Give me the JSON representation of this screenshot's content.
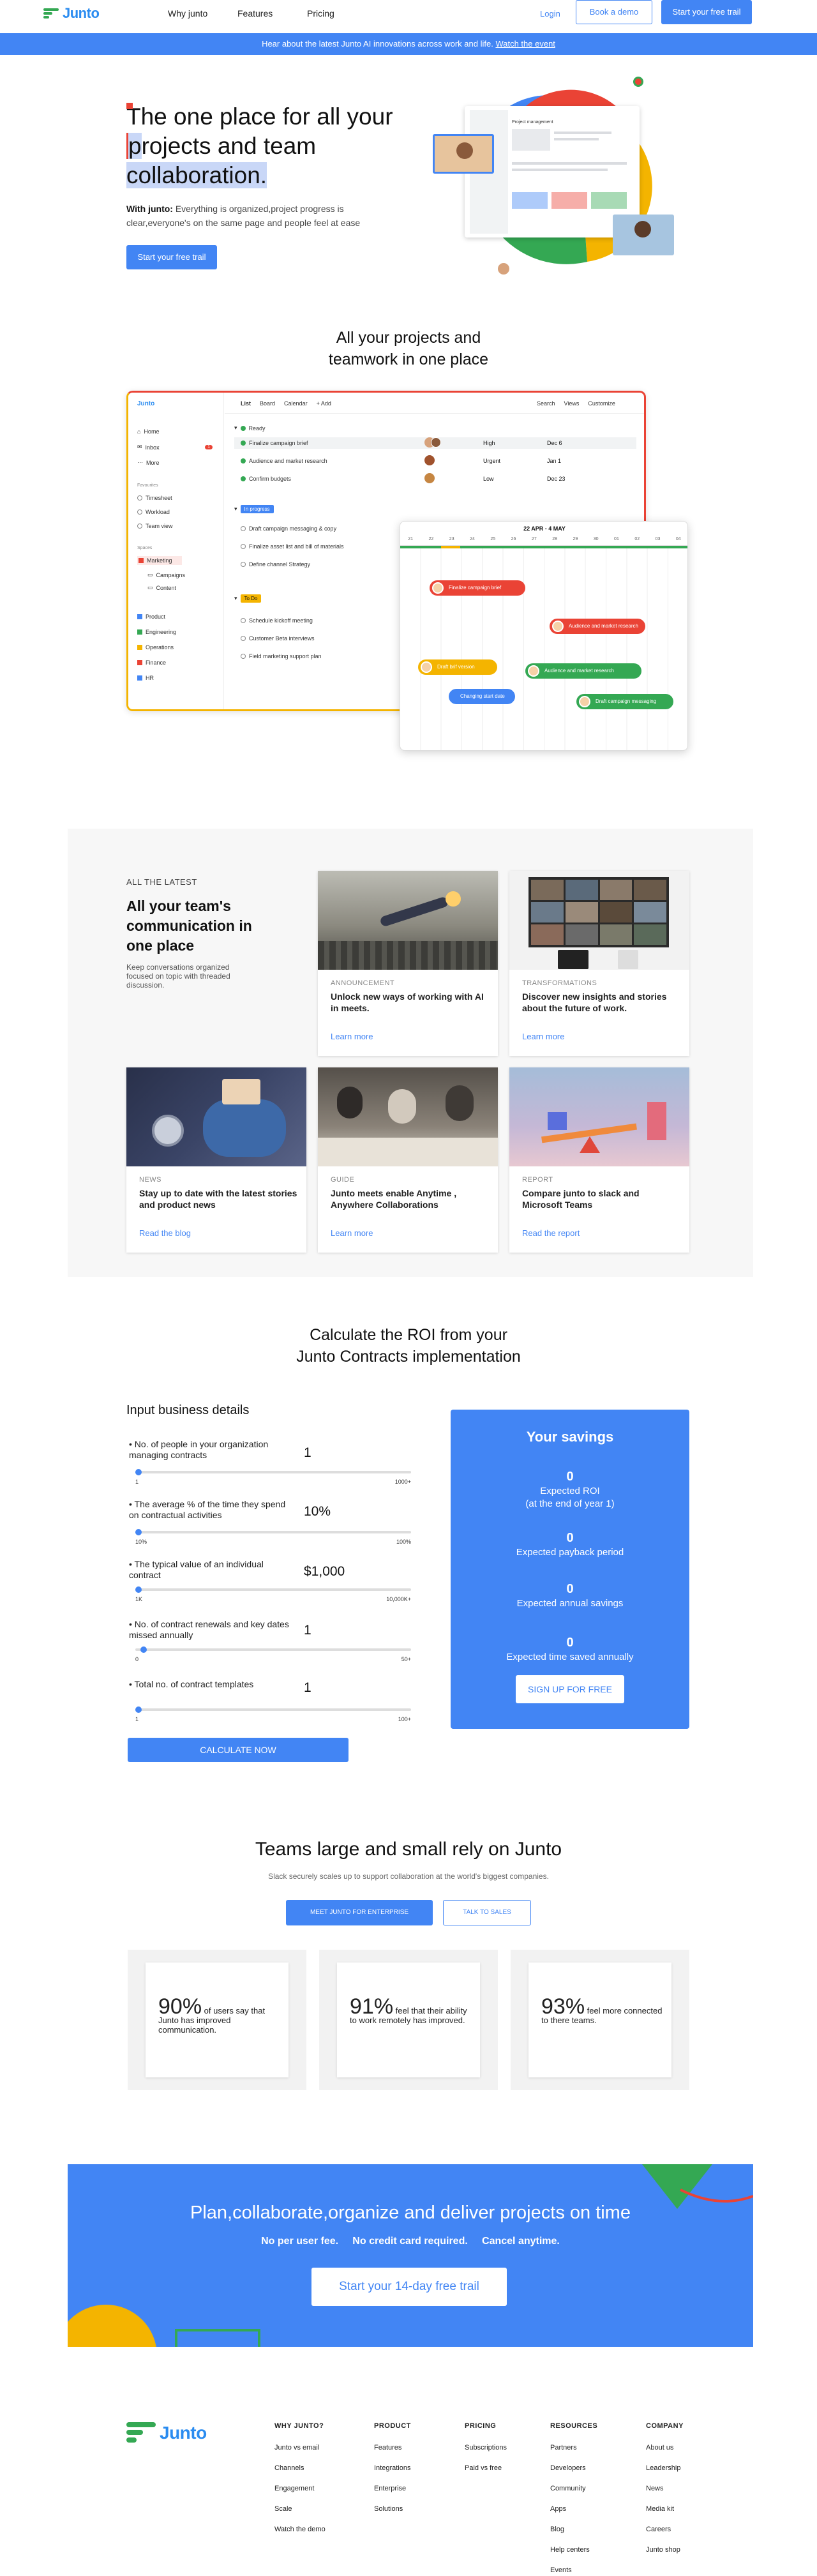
{
  "nav": {
    "brand": "Junto",
    "links": [
      "Why junto",
      "Features",
      "Pricing"
    ],
    "login": "Login",
    "book_demo": "Book a demo",
    "cta": "Start your free trail"
  },
  "banner": {
    "text": "Hear about the latest Junto AI innovations across work and life.",
    "link": "Watch the event"
  },
  "hero": {
    "title_line1": "The one place for all your",
    "title_line2a": "p",
    "title_line2b": "rojects and team",
    "title_line3": "collaboration.",
    "sub_bold": "With junto:",
    "sub_text": " Everything is organized,project progress is clear,everyone's on the same page and people feel at ease",
    "cta": "Start your free trail",
    "mini_title": "Project management"
  },
  "projects": {
    "title_line1": "All your projects and",
    "title_line2": "teamwork in one place",
    "mock": {
      "brand": "Junto",
      "nav": [
        "Home",
        "Inbox",
        "More"
      ],
      "inbox_count": "1",
      "favorites_heading": "Favourites",
      "favorites": [
        "Timesheet",
        "Workload",
        "Team view"
      ],
      "spaces_heading": "Spaces",
      "space_active": "Marketing",
      "space_items": [
        "Campaigns",
        "Content"
      ],
      "teams": [
        "Product",
        "Engineering",
        "Operations",
        "Finance",
        "HR"
      ],
      "tabs": [
        "List",
        "Board",
        "Calendar",
        "+ Add"
      ],
      "tools": [
        "Search",
        "Views",
        "Customize"
      ],
      "group_ready": "Ready",
      "ready_tasks": [
        {
          "name": "Finalize campaign brief",
          "priority": "High",
          "date": "Dec 6"
        },
        {
          "name": "Audience and market research",
          "priority": "Urgent",
          "date": "Jan 1"
        },
        {
          "name": "Confirm budgets",
          "priority": "Low",
          "date": "Dec 23"
        }
      ],
      "group_progress": "In progress",
      "progress_tasks": [
        "Draft campaign messaging & copy",
        "Finalize asset list and bill of materials",
        "Define channel Strategy"
      ],
      "group_todo": "To Do",
      "todo_tasks": [
        "Schedule kickoff meeting",
        "Customer Beta interviews",
        "Field marketing support plan"
      ]
    },
    "gantt": {
      "range": "22 APR - 4 MAY",
      "days": [
        "21",
        "22",
        "23",
        "24",
        "25",
        "26",
        "27",
        "28",
        "29",
        "30",
        "01",
        "02",
        "03",
        "04"
      ],
      "bars": [
        {
          "label": "Finalize campaign brief",
          "color": "#ea4335"
        },
        {
          "label": "Audience and market research",
          "color": "#ea4335"
        },
        {
          "label": "Draft brif version",
          "color": "#f4b400"
        },
        {
          "label": "Audience and market research",
          "color": "#34a853"
        },
        {
          "label": "Changing start date",
          "color": "#4285f4"
        },
        {
          "label": "Draft campaign messaging",
          "color": "#34a853"
        }
      ]
    }
  },
  "latest": {
    "eyebrow": "ALL THE LATEST",
    "title": "All your team's communication in one place",
    "sub": "Keep conversations organized focused on topic with threaded discussion.",
    "cards": [
      {
        "cat": "ANNOUNCEMENT",
        "title": "Unlock new ways of working with AI in meets.",
        "link": "Learn more"
      },
      {
        "cat": "TRANSFORMATIONS",
        "title": "Discover new insights and stories about the future of work.",
        "link": "Learn more"
      },
      {
        "cat": "NEWS",
        "title": "Stay up to date with the latest stories and product news",
        "link": "Read the blog"
      },
      {
        "cat": "GUIDE",
        "title": "Junto meets enable Anytime , Anywhere Collaborations",
        "link": "Learn more"
      },
      {
        "cat": "REPORT",
        "title": "Compare junto to slack and Microsoft Teams",
        "link": "Read the report"
      }
    ]
  },
  "roi": {
    "title_line1": "Calculate the ROI from your",
    "title_line2": "Junto Contracts implementation",
    "input_heading": "Input business details",
    "fields": [
      {
        "label": "No. of people in your organization managing contracts",
        "value": "1",
        "min": "1",
        "max": "1000+",
        "level": 0
      },
      {
        "label": "The average % of the time they spend on contractual activities",
        "value": "10%",
        "min": "10%",
        "max": "100%",
        "level": 0
      },
      {
        "label": "The typical value of an individual contract",
        "value": "$1,000",
        "min": "1K",
        "max": "10,000K+",
        "level": 0
      },
      {
        "label": "No. of contract renewals and key dates missed annually",
        "value": "1",
        "min": "0",
        "max": "50+",
        "level": 0.02
      },
      {
        "label": "Total no. of contract templates",
        "value": "1",
        "min": "1",
        "max": "100+",
        "level": 0
      }
    ],
    "calculate": "CALCULATE NOW",
    "savings_title": "Your savings",
    "savings": [
      {
        "value": "0",
        "label1": "Expected ROI",
        "label2": "(at the end of year 1)"
      },
      {
        "value": "0",
        "label1": "Expected payback period",
        "label2": ""
      },
      {
        "value": "0",
        "label1": "Expected annual savings",
        "label2": ""
      },
      {
        "value": "0",
        "label1": "Expected time saved annually",
        "label2": ""
      }
    ],
    "signup": "SIGN UP FOR FREE"
  },
  "trust": {
    "title": "Teams large and small rely on Junto",
    "sub": "Slack securely scales up to support collaboration at the world's biggest companies.",
    "enterprise": "MEET JUNTO FOR ENTERPRISE",
    "sales": "TALK TO SALES",
    "stats": [
      {
        "num": "90%",
        "text": " of users say that Junto has improved communication."
      },
      {
        "num": "91%",
        "text": " feel that their ability to work remotely has improved."
      },
      {
        "num": "93%",
        "text": " feel more connected to there teams."
      }
    ]
  },
  "cta": {
    "title": "Plan,collaborate,organize and deliver projects on time",
    "points": [
      "No per user fee.",
      "No credit card required.",
      "Cancel anytime."
    ],
    "button": "Start your 14-day free trail"
  },
  "footer": {
    "brand": "Junto",
    "columns": [
      {
        "title": "WHY JUNTO?",
        "items": [
          "Junto vs email",
          "Channels",
          "Engagement",
          "Scale",
          "Watch the demo"
        ]
      },
      {
        "title": "PRODUCT",
        "items": [
          "Features",
          "Integrations",
          "Enterprise",
          "Solutions"
        ]
      },
      {
        "title": "PRICING",
        "items": [
          "Subscriptions",
          "Paid vs free"
        ]
      },
      {
        "title": "RESOURCES",
        "items": [
          "Partners",
          "Developers",
          "Community",
          "Apps",
          "Blog",
          "Help centers",
          "Events"
        ]
      },
      {
        "title": "COMPANY",
        "items": [
          "About us",
          "Leadership",
          "News",
          "Media kit",
          "Careers",
          "Junto shop"
        ]
      }
    ]
  },
  "colors": {
    "primary": "#4285f4",
    "red": "#ea4335",
    "yellow": "#f4b400",
    "green": "#34a853"
  }
}
